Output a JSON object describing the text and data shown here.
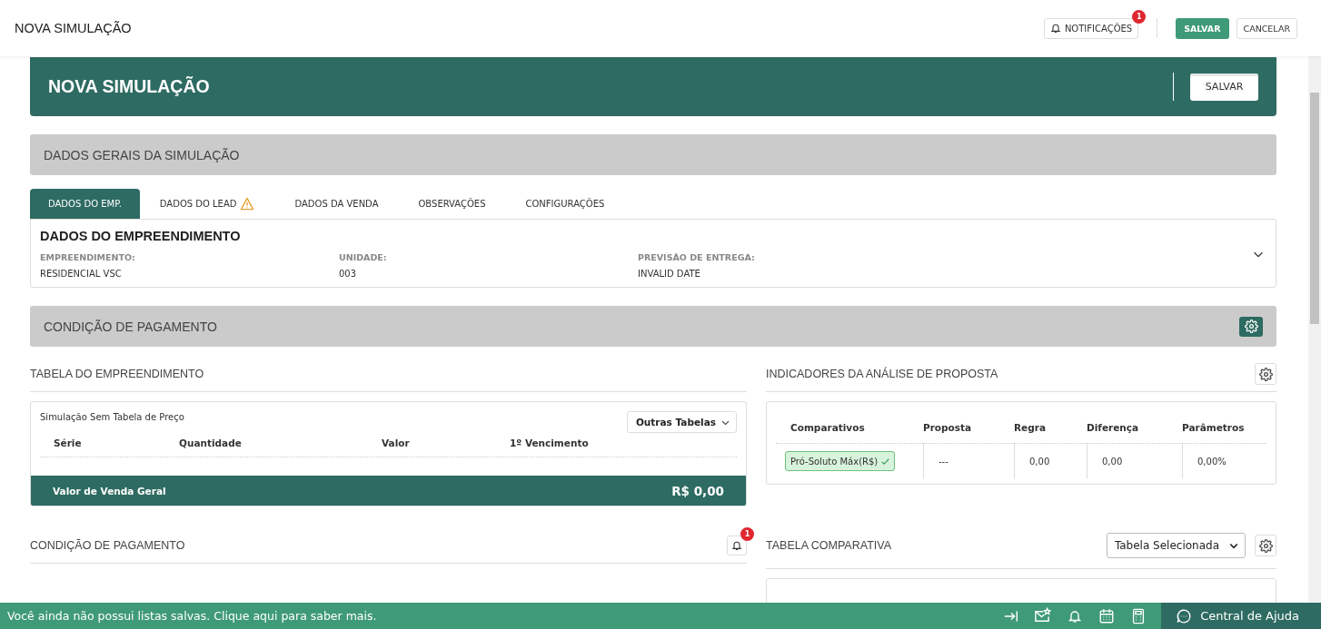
{
  "header": {
    "title": "NOVA SIMULAÇÃO",
    "notifications": {
      "label": "NOTIFICAÇÕES",
      "badge": "1"
    },
    "save": "SALVAR",
    "cancel": "CANCELAR"
  },
  "banner": {
    "title": "NOVA SIMULAÇÃO",
    "save": "SALVAR"
  },
  "general_section": {
    "title": "DADOS GERAIS DA SIMULAÇÃO"
  },
  "tabs": [
    {
      "label": "DADOS DO EMP.",
      "selected": true,
      "warning": false
    },
    {
      "label": "DADOS DO LEAD",
      "selected": false,
      "warning": true
    },
    {
      "label": "DADOS DA VENDA",
      "selected": false,
      "warning": false
    },
    {
      "label": "OBSERVAÇÕES",
      "selected": false,
      "warning": false
    },
    {
      "label": "CONFIGURAÇÕES",
      "selected": false,
      "warning": false
    }
  ],
  "development": {
    "title": "DADOS DO EMPREENDIMENTO",
    "fields": [
      {
        "label": "EMPREENDIMENTO:",
        "value": "RESIDENCIAL VSC"
      },
      {
        "label": "UNIDADE:",
        "value": "003"
      },
      {
        "label": "PREVISÃO DE ENTREGA:",
        "value": "INVALID DATE"
      }
    ]
  },
  "payment_section": {
    "title": "CONDIÇÃO DE PAGAMENTO"
  },
  "development_table": {
    "title": "TABELA DO EMPREENDIMENTO",
    "subtitle": "Simulação Sem Tabela de Preço",
    "dropdown": "Outras Tabelas",
    "columns": [
      "Série",
      "Quantidade",
      "Valor",
      "1º Vencimento"
    ],
    "total_label": "Valor de Venda Geral",
    "total_value": "R$ 0,00"
  },
  "indicators": {
    "title": "INDICADORES DA ANÁLISE DE PROPOSTA",
    "columns": [
      "Comparativos",
      "Proposta",
      "Regra",
      "Diferença",
      "Parâmetros"
    ],
    "rows": [
      {
        "comparison": "Pró-Soluto Máx(R$)",
        "ok": true,
        "proposal": "---",
        "rule": "0,00",
        "difference": "0,00",
        "parameters": "0,00%"
      }
    ]
  },
  "payment_condition": {
    "title": "CONDIÇÃO DE PAGAMENTO",
    "badge": "1"
  },
  "comparison_table": {
    "title": "TABELA COMPARATIVA",
    "select": "Tabela Selecionada"
  },
  "status_bar": {
    "message": "Você ainda não possui listas salvas. Clique aqui para saber mais.",
    "help": "Central de Ajuda"
  }
}
